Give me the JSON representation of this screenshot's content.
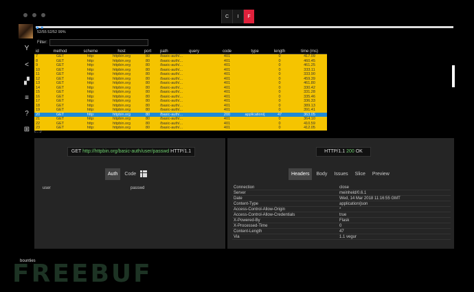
{
  "window": {
    "mode_buttons": [
      {
        "label": "C",
        "active": false
      },
      {
        "label": "I",
        "active": false
      },
      {
        "label": "F",
        "active": true
      }
    ]
  },
  "timeline": {
    "time_text": "52/55 52/52 99%"
  },
  "filter": {
    "label": "Filter:",
    "value": ""
  },
  "table": {
    "columns": [
      "id",
      "method",
      "scheme",
      "host",
      "port",
      "path",
      "query",
      "code",
      "type",
      "length",
      "time (ms)"
    ],
    "rows": [
      [
        "7",
        "GET",
        "http:",
        "httpbin.org",
        "80",
        "/basic-auth/...",
        "",
        "401",
        "",
        "0",
        "417.09"
      ],
      [
        "8",
        "GET",
        "http:",
        "httpbin.org",
        "80",
        "/basic-auth/...",
        "",
        "401",
        "",
        "0",
        "460.45"
      ],
      [
        "9",
        "GET",
        "http:",
        "httpbin.org",
        "80",
        "/basic-auth/...",
        "",
        "401",
        "",
        "0",
        "461.25"
      ],
      [
        "10",
        "GET",
        "http:",
        "httpbin.org",
        "80",
        "/basic-auth/...",
        "",
        "401",
        "",
        "0",
        "333.11"
      ],
      [
        "11",
        "GET",
        "http:",
        "httpbin.org",
        "80",
        "/basic-auth/...",
        "",
        "401",
        "",
        "0",
        "333.90"
      ],
      [
        "12",
        "GET",
        "http:",
        "httpbin.org",
        "80",
        "/basic-auth/...",
        "",
        "401",
        "",
        "0",
        "459.39"
      ],
      [
        "13",
        "GET",
        "http:",
        "httpbin.org",
        "80",
        "/basic-auth/...",
        "",
        "401",
        "",
        "0",
        "461.80"
      ],
      [
        "14",
        "GET",
        "http:",
        "httpbin.org",
        "80",
        "/basic-auth/...",
        "",
        "401",
        "",
        "0",
        "330.42"
      ],
      [
        "15",
        "GET",
        "http:",
        "httpbin.org",
        "80",
        "/basic-auth/...",
        "",
        "401",
        "",
        "0",
        "331.28"
      ],
      [
        "16",
        "GET",
        "http:",
        "httpbin.org",
        "80",
        "/basic-auth/...",
        "",
        "401",
        "",
        "0",
        "335.46"
      ],
      [
        "17",
        "GET",
        "http:",
        "httpbin.org",
        "80",
        "/basic-auth/...",
        "",
        "401",
        "",
        "0",
        "336.33"
      ],
      [
        "18",
        "GET",
        "http:",
        "httpbin.org",
        "80",
        "/basic-auth/...",
        "",
        "401",
        "",
        "0",
        "389.13"
      ],
      [
        "19",
        "GET",
        "http:",
        "httpbin.org",
        "80",
        "/basic-auth/...",
        "",
        "401",
        "",
        "0",
        "391.41"
      ],
      [
        "20",
        "GET",
        "http:",
        "httpbin.org",
        "80",
        "/basic-auth/...",
        "",
        "200",
        "application/j",
        "47",
        "363.05"
      ],
      [
        "21",
        "GET",
        "http:",
        "httpbin.org",
        "80",
        "/basic-auth/...",
        "",
        "401",
        "",
        "0",
        "364.10"
      ],
      [
        "22",
        "GET",
        "http:",
        "httpbin.org",
        "80",
        "/basic-auth/...",
        "",
        "401",
        "",
        "0",
        "410.59"
      ],
      [
        "23",
        "GET",
        "http:",
        "httpbin.org",
        "80",
        "/basic-auth/...",
        "",
        "401",
        "",
        "0",
        "412.05"
      ]
    ],
    "selected_id": "20"
  },
  "path_hint": "c:..:J",
  "request": {
    "method": "GET",
    "url": "http://httpbin.org/basic-auth/user/passwd",
    "version": "HTTP/1.1"
  },
  "response": {
    "version": "HTTP/1.1",
    "status": "200",
    "reason": "OK"
  },
  "left_tabs": [
    {
      "label": "Auth",
      "active": true
    },
    {
      "label": "Code",
      "active": false
    }
  ],
  "right_tabs": [
    {
      "label": "Headers",
      "active": true
    },
    {
      "label": "Body",
      "active": false
    },
    {
      "label": "Issues",
      "active": false
    },
    {
      "label": "Slice",
      "active": false
    },
    {
      "label": "Preview",
      "active": false
    }
  ],
  "auth": {
    "user_label": "user",
    "pass_label": "passwd"
  },
  "headers": [
    [
      "Connection",
      "close"
    ],
    [
      "Server",
      "meinheld/0.6.1"
    ],
    [
      "Date",
      "Wed, 14 Mar 2018 11:16:55 GMT"
    ],
    [
      "Content-Type",
      "application/json"
    ],
    [
      "Access-Control-Allow-Origin",
      "*"
    ],
    [
      "Access-Control-Allow-Credentials",
      "true"
    ],
    [
      "X-Powered-By",
      "Flask"
    ],
    [
      "X-Processed-Time",
      "0"
    ],
    [
      "Content-Length",
      "47"
    ],
    [
      "Via",
      "1.1 vegur"
    ]
  ],
  "footer": {
    "bounties": "bounties",
    "watermark": "FREEBUF"
  },
  "colors": {
    "row": "#f5c400",
    "selected": "#1f8ad6",
    "accent": "#e0213b",
    "green": "#6fcf6f"
  },
  "icons": [
    "chevron-y-icon",
    "share-icon",
    "dashboard-icon",
    "sort-icon",
    "help-icon",
    "grid-icon"
  ]
}
